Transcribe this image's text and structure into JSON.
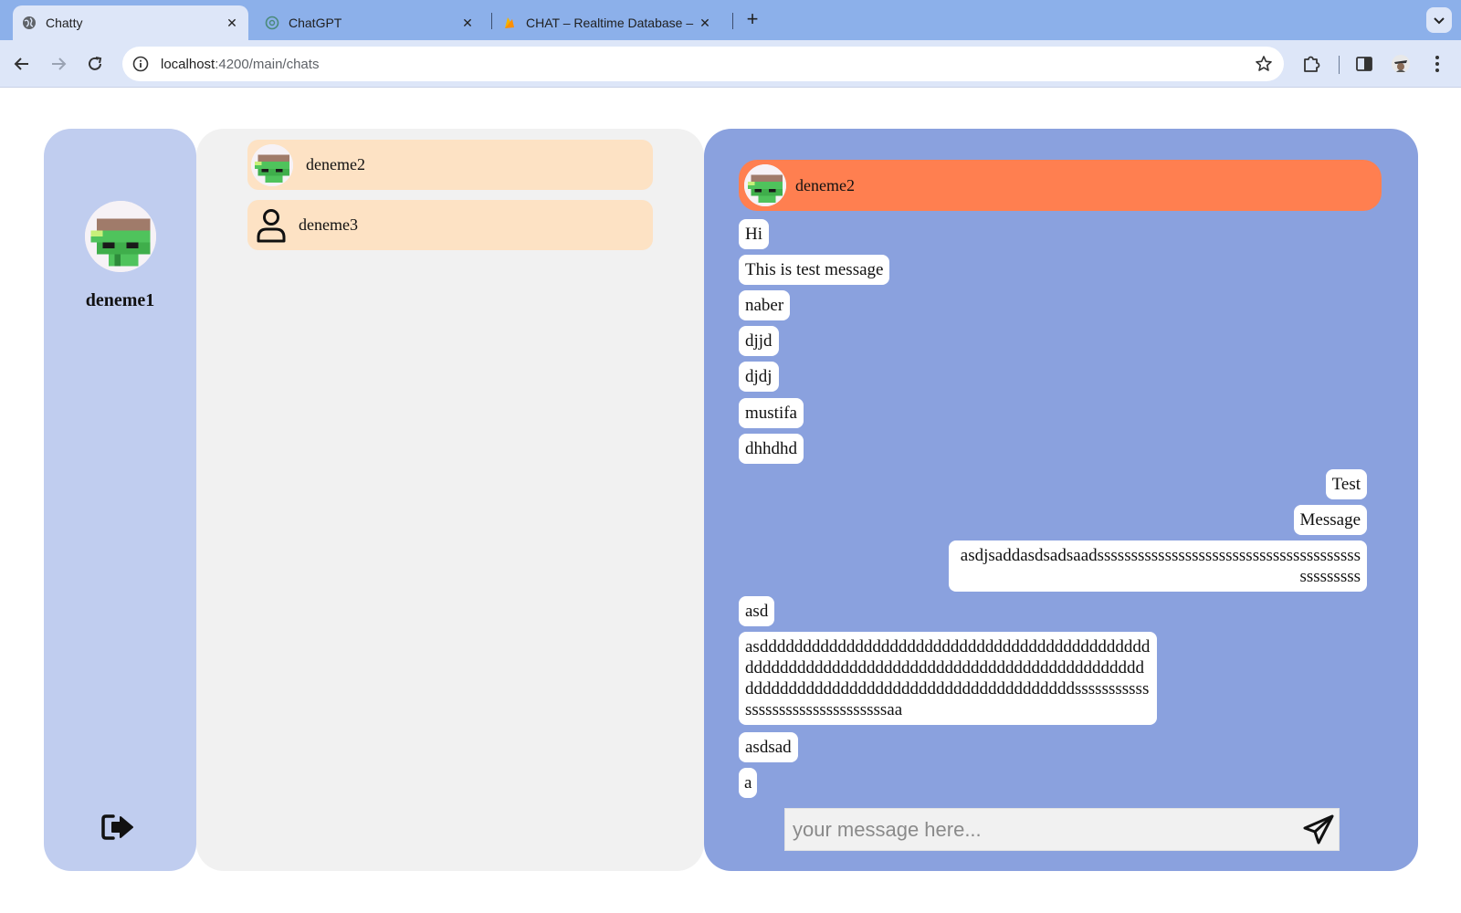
{
  "browser": {
    "tabs": [
      {
        "title": "Chatty"
      },
      {
        "title": "ChatGPT"
      },
      {
        "title": "CHAT – Realtime Database –"
      }
    ],
    "url_host": "localhost",
    "url_path": ":4200/main/chats"
  },
  "profile": {
    "name": "deneme1"
  },
  "chat_list": [
    {
      "name": "deneme2",
      "avatar": "pixel-avatar"
    },
    {
      "name": "deneme3",
      "avatar": "person-icon"
    }
  ],
  "conversation": {
    "contact_name": "deneme2",
    "messages": [
      {
        "text": "Hi",
        "side": "left"
      },
      {
        "text": "This is test message",
        "side": "left"
      },
      {
        "text": "naber",
        "side": "left"
      },
      {
        "text": "djjd",
        "side": "left"
      },
      {
        "text": "djdj",
        "side": "left"
      },
      {
        "text": "mustifa",
        "side": "left"
      },
      {
        "text": "dhhdhd",
        "side": "left"
      },
      {
        "text": "Test",
        "side": "right"
      },
      {
        "text": "Message",
        "side": "right"
      },
      {
        "text": "asdjsaddasdsadsaadssssssssssssssssssssssssssssssssssssssssssssssss",
        "side": "right"
      },
      {
        "text": "asd",
        "side": "left"
      },
      {
        "text": "asdddddddddddddddddddddddddddddddddddddddddddddddddddddddddddddddddddddddddddddddddddddddddddddddddddddddddddddddddddddddddddddddddssssssssssssssssssssssssssssssssaa",
        "side": "left"
      },
      {
        "text": "asdsad",
        "side": "left"
      },
      {
        "text": "a",
        "side": "left"
      }
    ],
    "composer_placeholder": "your message here..."
  },
  "colors": {
    "sidebar_bg": "#c0cdef",
    "chatlist_bg": "#f1f1f1",
    "chat_item_bg": "#fde2c4",
    "conversation_bg": "#8aa1de",
    "header_bg": "#ff7f50"
  }
}
